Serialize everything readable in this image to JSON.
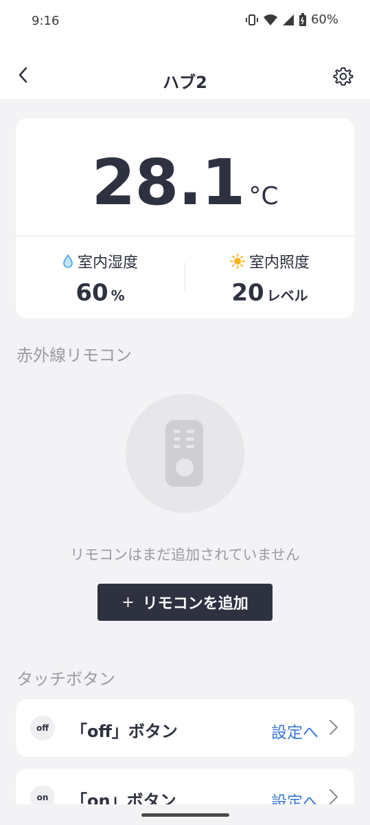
{
  "status_bar": {
    "time": "9:16",
    "battery_percent": "60%"
  },
  "app_bar": {
    "title": "ハブ2",
    "icons": {
      "back": "chevron-left-icon",
      "settings": "gear-icon"
    }
  },
  "sensor": {
    "temperature": "28.1",
    "temperature_unit": "°C",
    "humidity_label": "室内湿度",
    "humidity_value": "60",
    "humidity_unit": "%",
    "illuminance_label": "室内照度",
    "illuminance_value": "20",
    "illuminance_unit": "レベル",
    "icons": {
      "humidity": "water-drop-icon",
      "illuminance": "sun-icon"
    }
  },
  "ir_remote": {
    "section_title": "赤外線リモコン",
    "empty_message": "リモコンはまだ追加されていません",
    "add_button_label": "リモコンを追加",
    "add_button_plus": "+"
  },
  "touch_buttons": {
    "section_title": "タッチボタン",
    "items": [
      {
        "icon_text": "off",
        "label": "「off」ボタン",
        "link": "設定へ"
      },
      {
        "icon_text": "on",
        "label": "「on」ボタン",
        "link": "設定へ"
      }
    ]
  },
  "colors": {
    "accent_link": "#3a78d4",
    "dark_button": "#2e3240",
    "background": "#f3f3f5"
  }
}
